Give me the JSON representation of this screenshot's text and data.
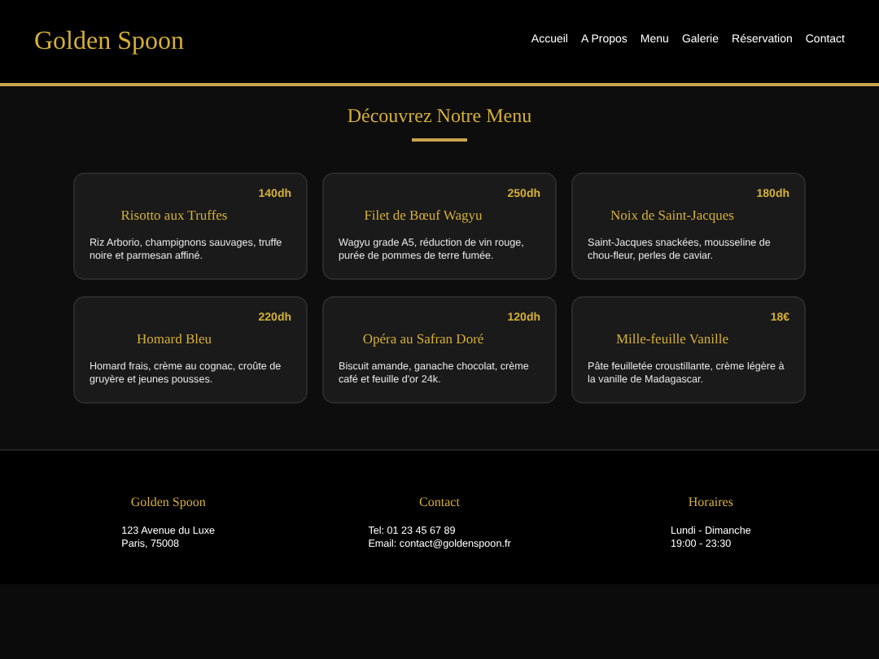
{
  "header": {
    "logo": "Golden Spoon",
    "nav": [
      {
        "label": "Accueil"
      },
      {
        "label": "A Propos"
      },
      {
        "label": "Menu"
      },
      {
        "label": "Galerie"
      },
      {
        "label": "Réservation"
      },
      {
        "label": "Contact"
      }
    ]
  },
  "menu": {
    "title": "Découvrez Notre Menu",
    "items": [
      {
        "price": "140dh",
        "name": "Risotto aux Truffes",
        "description": "Riz Arborio, champignons sauvages, truffe noire et parmesan affiné."
      },
      {
        "price": "250dh",
        "name": "Filet de Bœuf Wagyu",
        "description": "Wagyu grade A5, réduction de vin rouge, purée de pommes de terre fumée."
      },
      {
        "price": "180dh",
        "name": "Noix de Saint-Jacques",
        "description": "Saint-Jacques snackées, mousseline de chou-fleur, perles de caviar."
      },
      {
        "price": "220dh",
        "name": "Homard Bleu",
        "description": "Homard frais, crème au cognac, croûte de gruyère et jeunes pousses."
      },
      {
        "price": "120dh",
        "name": "Opéra au Safran Doré",
        "description": "Biscuit amande, ganache chocolat, crème café et feuille d'or 24k."
      },
      {
        "price": "18€",
        "name": "Mille-feuille Vanille",
        "description": "Pâte feuilletée croustillante, crème légère à la vanille de Madagascar."
      }
    ]
  },
  "footer": {
    "columns": [
      {
        "heading": "Golden Spoon",
        "lines": [
          "123 Avenue du Luxe",
          "Paris, 75008"
        ]
      },
      {
        "heading": "Contact",
        "lines": [
          "Tel: 01 23 45 67 89",
          "Email: contact@goldenspoon.fr"
        ]
      },
      {
        "heading": "Horaires",
        "lines": [
          "Lundi - Dimanche",
          "19:00 - 23:30"
        ]
      }
    ]
  }
}
